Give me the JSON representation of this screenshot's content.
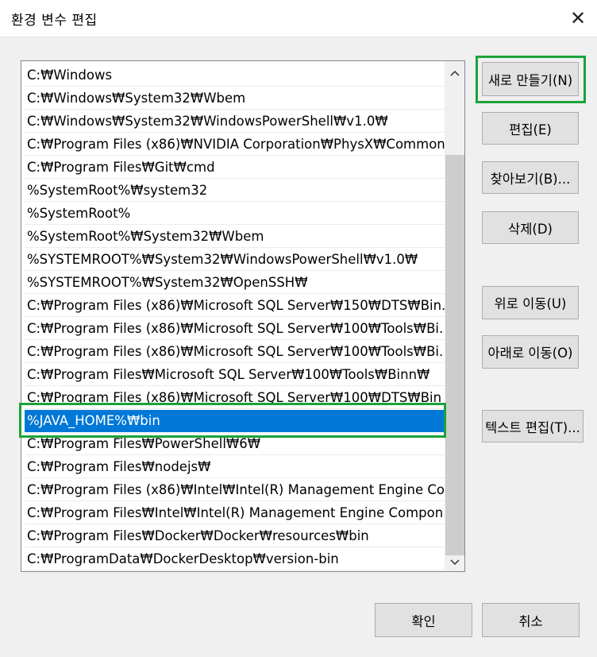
{
  "window": {
    "title": "환경 변수 편집",
    "close_glyph": "✕"
  },
  "list": {
    "items": [
      "C:₩Windows",
      "C:₩Windows₩System32₩Wbem",
      "C:₩Windows₩System32₩WindowsPowerShell₩v1.0₩",
      "C:₩Program Files (x86)₩NVIDIA Corporation₩PhysX₩Common",
      "C:₩Program Files₩Git₩cmd",
      "%SystemRoot%₩system32",
      "%SystemRoot%",
      "%SystemRoot%₩System32₩Wbem",
      "%SYSTEMROOT%₩System32₩WindowsPowerShell₩v1.0₩",
      "%SYSTEMROOT%₩System32₩OpenSSH₩",
      "C:₩Program Files (x86)₩Microsoft SQL Server₩150₩DTS₩Bin...",
      "C:₩Program Files (x86)₩Microsoft SQL Server₩100₩Tools₩Bi...",
      "C:₩Program Files (x86)₩Microsoft SQL Server₩100₩Tools₩Bi...",
      "C:₩Program Files₩Microsoft SQL Server₩100₩Tools₩Binn₩",
      "C:₩Program Files (x86)₩Microsoft SQL Server₩100₩DTS₩Bin",
      "%JAVA_HOME%₩bin",
      "C:₩Program Files₩PowerShell₩6₩",
      "C:₩Program Files₩nodejs₩",
      "C:₩Program Files (x86)₩Intel₩Intel(R) Management Engine Co...",
      "C:₩Program Files₩Intel₩Intel(R) Management Engine Compon...",
      "C:₩Program Files₩Docker₩Docker₩resources₩bin",
      "C:₩ProgramData₩DockerDesktop₩version-bin"
    ],
    "selected_index": 15
  },
  "buttons": {
    "new": "새로 만들기(N)",
    "edit": "편집(E)",
    "browse": "찾아보기(B)...",
    "delete": "삭제(D)",
    "move_up": "위로 이동(U)",
    "move_down": "아래로 이동(O)",
    "edit_text": "텍스트 편집(T)...",
    "ok": "확인",
    "cancel": "취소"
  },
  "colors": {
    "selection": "#0078d7",
    "highlight_outline": "#1ba33a"
  }
}
